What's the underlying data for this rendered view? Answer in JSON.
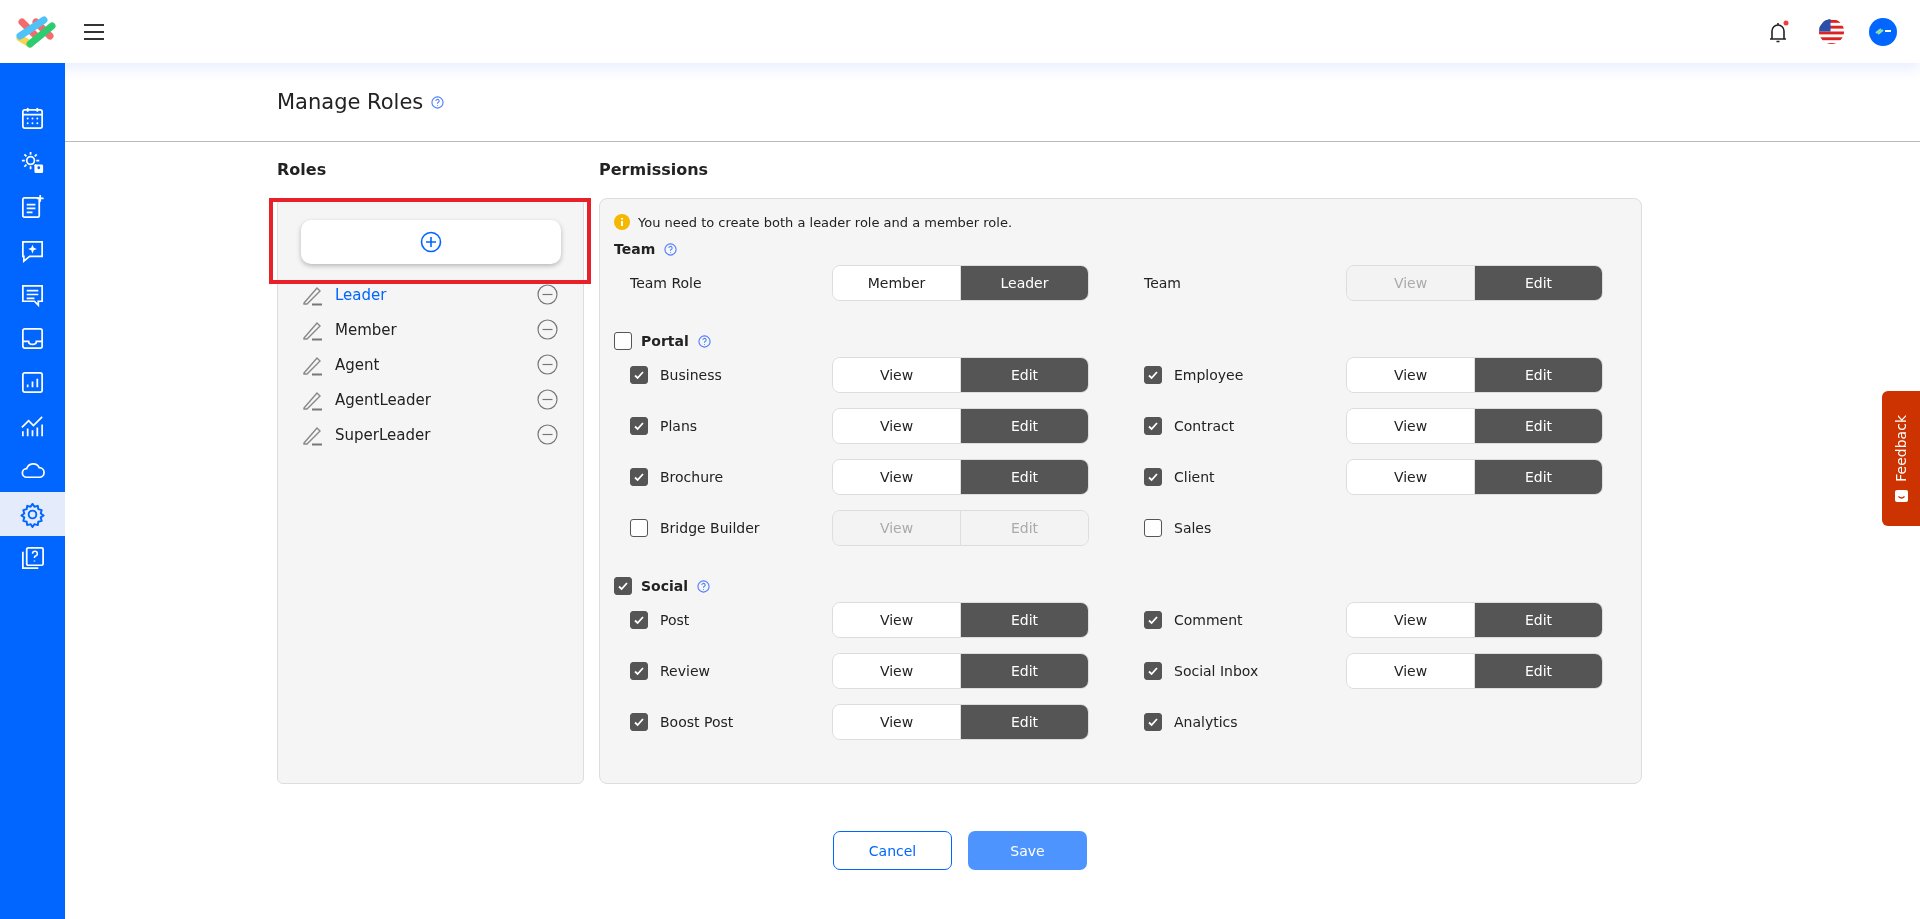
{
  "sidebar": {
    "items": [
      {
        "selected": false
      },
      {
        "selected": false
      },
      {
        "selected": false
      },
      {
        "selected": false
      },
      {
        "selected": false
      },
      {
        "selected": false
      },
      {
        "selected": false
      },
      {
        "selected": false
      },
      {
        "selected": false
      },
      {
        "selected": true
      },
      {
        "selected": false
      }
    ]
  },
  "page": {
    "title": "Manage Roles"
  },
  "roles": {
    "heading": "Roles",
    "items": [
      {
        "name": "Leader",
        "selected": true
      },
      {
        "name": "Member",
        "selected": false
      },
      {
        "name": "Agent",
        "selected": false
      },
      {
        "name": "AgentLeader",
        "selected": false
      },
      {
        "name": "SuperLeader",
        "selected": false
      }
    ]
  },
  "permissions": {
    "heading": "Permissions",
    "notice": "You need to create both a leader role and a member role.",
    "sections": [
      {
        "title": "Team",
        "kind": "plain",
        "items": [
          {
            "label": "Team Role",
            "kind": "plain",
            "toggle": [
              {
                "label": "Member",
                "selected": false,
                "disabled": false
              },
              {
                "label": "Leader",
                "selected": true,
                "disabled": false
              }
            ]
          },
          {
            "label": "Team",
            "kind": "plain",
            "toggle": [
              {
                "label": "View",
                "selected": false,
                "disabled": true
              },
              {
                "label": "Edit",
                "selected": true,
                "disabled": false
              }
            ]
          }
        ]
      },
      {
        "title": "Portal",
        "kind": "check",
        "checked": false,
        "items": [
          {
            "label": "Business",
            "kind": "check",
            "checked": true,
            "toggle": [
              {
                "label": "View",
                "selected": false,
                "disabled": false
              },
              {
                "label": "Edit",
                "selected": true,
                "disabled": false
              }
            ]
          },
          {
            "label": "Employee",
            "kind": "check",
            "checked": true,
            "toggle": [
              {
                "label": "View",
                "selected": false,
                "disabled": false
              },
              {
                "label": "Edit",
                "selected": true,
                "disabled": false
              }
            ]
          },
          {
            "label": "Plans",
            "kind": "check",
            "checked": true,
            "toggle": [
              {
                "label": "View",
                "selected": false,
                "disabled": false
              },
              {
                "label": "Edit",
                "selected": true,
                "disabled": false
              }
            ]
          },
          {
            "label": "Contract",
            "kind": "check",
            "checked": true,
            "toggle": [
              {
                "label": "View",
                "selected": false,
                "disabled": false
              },
              {
                "label": "Edit",
                "selected": true,
                "disabled": false
              }
            ]
          },
          {
            "label": "Brochure",
            "kind": "check",
            "checked": true,
            "toggle": [
              {
                "label": "View",
                "selected": false,
                "disabled": false
              },
              {
                "label": "Edit",
                "selected": true,
                "disabled": false
              }
            ]
          },
          {
            "label": "Client",
            "kind": "check",
            "checked": true,
            "toggle": [
              {
                "label": "View",
                "selected": false,
                "disabled": false
              },
              {
                "label": "Edit",
                "selected": true,
                "disabled": false
              }
            ]
          },
          {
            "label": "Bridge Builder",
            "kind": "check",
            "checked": false,
            "toggle": [
              {
                "label": "View",
                "selected": false,
                "disabled": true
              },
              {
                "label": "Edit",
                "selected": false,
                "disabled": true
              }
            ]
          },
          {
            "label": "Sales",
            "kind": "check",
            "checked": false
          }
        ]
      },
      {
        "title": "Social",
        "kind": "check",
        "checked": true,
        "items": [
          {
            "label": "Post",
            "kind": "check",
            "checked": true,
            "toggle": [
              {
                "label": "View",
                "selected": false,
                "disabled": false
              },
              {
                "label": "Edit",
                "selected": true,
                "disabled": false
              }
            ]
          },
          {
            "label": "Comment",
            "kind": "check",
            "checked": true,
            "toggle": [
              {
                "label": "View",
                "selected": false,
                "disabled": false
              },
              {
                "label": "Edit",
                "selected": true,
                "disabled": false
              }
            ]
          },
          {
            "label": "Review",
            "kind": "check",
            "checked": true,
            "toggle": [
              {
                "label": "View",
                "selected": false,
                "disabled": false
              },
              {
                "label": "Edit",
                "selected": true,
                "disabled": false
              }
            ]
          },
          {
            "label": "Social Inbox",
            "kind": "check",
            "checked": true,
            "toggle": [
              {
                "label": "View",
                "selected": false,
                "disabled": false
              },
              {
                "label": "Edit",
                "selected": true,
                "disabled": false
              }
            ]
          },
          {
            "label": "Boost Post",
            "kind": "check",
            "checked": true,
            "toggle": [
              {
                "label": "View",
                "selected": false,
                "disabled": false
              },
              {
                "label": "Edit",
                "selected": true,
                "disabled": false
              }
            ]
          },
          {
            "label": "Analytics",
            "kind": "check",
            "checked": true
          }
        ]
      }
    ]
  },
  "actions": [
    {
      "label": "Cancel",
      "kind": "secondary"
    },
    {
      "label": "Save",
      "kind": "primary"
    }
  ],
  "feedback": {
    "label": "Feedback"
  }
}
